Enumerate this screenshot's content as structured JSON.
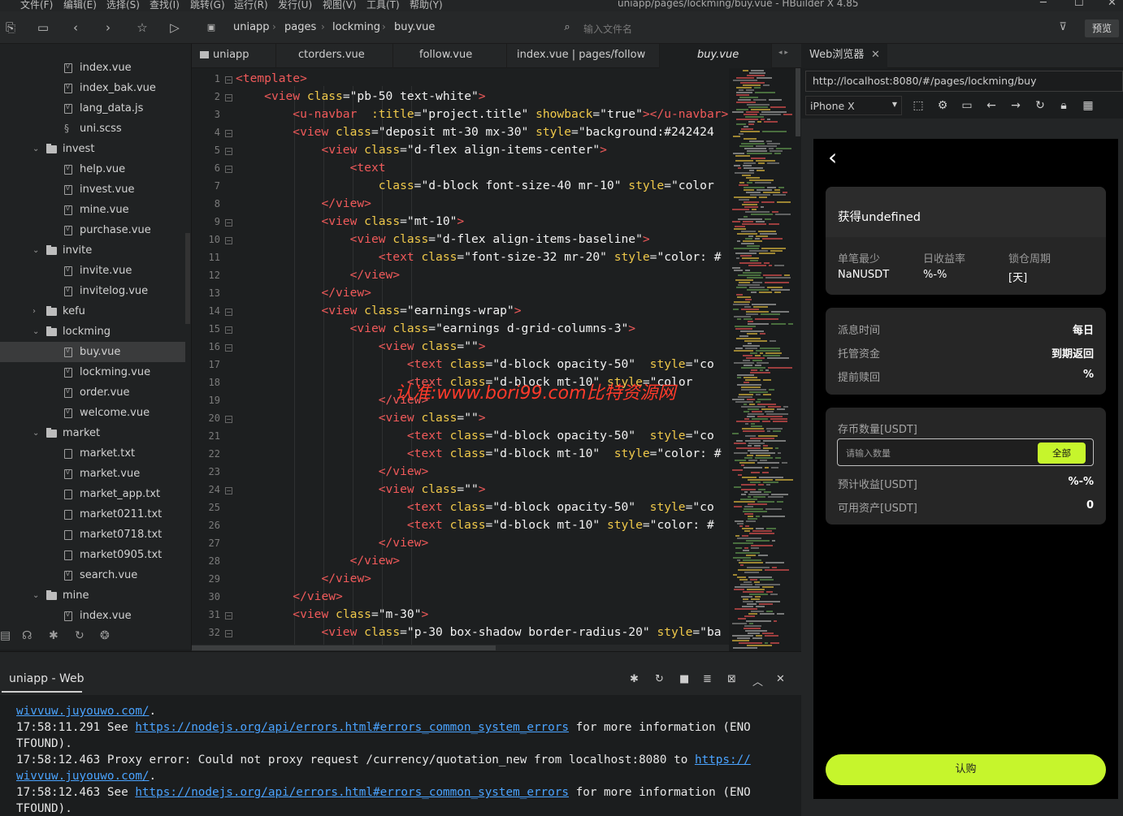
{
  "menu": [
    "文件(F)",
    "编辑(E)",
    "选择(S)",
    "查找(I)",
    "跳转(G)",
    "运行(R)",
    "发行(U)",
    "视图(V)",
    "工具(T)",
    "帮助(Y)"
  ],
  "window_title": "uniapp/pages/lockming/buy.vue - HBuilder X 4.85",
  "toolbar": {
    "breadcrumb": [
      "uniapp",
      "pages",
      "lockming",
      "buy.vue"
    ],
    "file_search_placeholder": "输入文件名",
    "preview_label": "预览"
  },
  "sidebar": {
    "items": [
      {
        "label": "index.vue",
        "kind": "file-vue",
        "depth": 2
      },
      {
        "label": "index_bak.vue",
        "kind": "file-vue",
        "depth": 2
      },
      {
        "label": "lang_data.js",
        "kind": "file-vue",
        "depth": 2
      },
      {
        "label": "uni.scss",
        "kind": "file-style",
        "depth": 2
      },
      {
        "label": "invest",
        "kind": "folder-open",
        "depth": 1
      },
      {
        "label": "help.vue",
        "kind": "file-vue",
        "depth": 2
      },
      {
        "label": "invest.vue",
        "kind": "file-vue",
        "depth": 2
      },
      {
        "label": "mine.vue",
        "kind": "file-vue",
        "depth": 2
      },
      {
        "label": "purchase.vue",
        "kind": "file-vue",
        "depth": 2
      },
      {
        "label": "invite",
        "kind": "folder-open",
        "depth": 1
      },
      {
        "label": "invite.vue",
        "kind": "file-vue",
        "depth": 2
      },
      {
        "label": "invitelog.vue",
        "kind": "file-vue",
        "depth": 2
      },
      {
        "label": "kefu",
        "kind": "folder-closed",
        "depth": 1
      },
      {
        "label": "lockming",
        "kind": "folder-open",
        "depth": 1
      },
      {
        "label": "buy.vue",
        "kind": "file-vue",
        "depth": 2,
        "selected": true
      },
      {
        "label": "lockming.vue",
        "kind": "file-vue",
        "depth": 2
      },
      {
        "label": "order.vue",
        "kind": "file-vue",
        "depth": 2
      },
      {
        "label": "welcome.vue",
        "kind": "file-vue",
        "depth": 2
      },
      {
        "label": "market",
        "kind": "folder-open",
        "depth": 1
      },
      {
        "label": "market.txt",
        "kind": "file-txt",
        "depth": 2
      },
      {
        "label": "market.vue",
        "kind": "file-vue",
        "depth": 2
      },
      {
        "label": "market_app.txt",
        "kind": "file-txt",
        "depth": 2
      },
      {
        "label": "market0211.txt",
        "kind": "file-txt",
        "depth": 2
      },
      {
        "label": "market0718.txt",
        "kind": "file-txt",
        "depth": 2
      },
      {
        "label": "market0905.txt",
        "kind": "file-txt",
        "depth": 2
      },
      {
        "label": "search.vue",
        "kind": "file-vue",
        "depth": 2
      },
      {
        "label": "mine",
        "kind": "folder-open",
        "depth": 1
      },
      {
        "label": "index.vue",
        "kind": "file-vue",
        "depth": 2
      }
    ]
  },
  "editor_tabs": [
    "uniapp",
    "ctorders.vue",
    "follow.vue",
    "index.vue | pages/follow",
    "buy.vue"
  ],
  "code_lines": [
    {
      "n": "1",
      "fold": true,
      "html": "<span class=\"t\">&lt;template&gt;</span>"
    },
    {
      "n": "2",
      "fold": true,
      "html": "    <span class=\"t\">&lt;view</span> <span class=\"a\">class</span>=<span class=\"s\">\"pb-50 text-white\"</span><span class=\"t\">&gt;</span>"
    },
    {
      "n": "3",
      "fold": false,
      "html": "        <span class=\"t\">&lt;u-navbar</span>  <span class=\"a\">:title</span>=<span class=\"s\">\"project.title\"</span> <span class=\"a\">showback</span>=<span class=\"s\">\"true\"</span><span class=\"t\">&gt;&lt;/u-navbar&gt;</span>"
    },
    {
      "n": "4",
      "fold": true,
      "html": "        <span class=\"t\">&lt;view</span> <span class=\"a\">class</span>=<span class=\"s\">\"deposit mt-30 mx-30\"</span> <span class=\"a\">style</span>=<span class=\"s\">\"background:#242424</span>"
    },
    {
      "n": "5",
      "fold": true,
      "html": "            <span class=\"t\">&lt;view</span> <span class=\"a\">class</span>=<span class=\"s\">\"d-flex align-items-center\"</span><span class=\"t\">&gt;</span>"
    },
    {
      "n": "6",
      "fold": true,
      "html": "                <span class=\"t\">&lt;text</span>"
    },
    {
      "n": "7",
      "fold": false,
      "html": "                    <span class=\"a\">class</span>=<span class=\"s\">\"d-block font-size-40 mr-10\"</span> <span class=\"a\">style</span>=<span class=\"s\">\"color</span>"
    },
    {
      "n": "8",
      "fold": false,
      "html": "            <span class=\"t\">&lt;/view&gt;</span>"
    },
    {
      "n": "9",
      "fold": true,
      "html": "            <span class=\"t\">&lt;view</span> <span class=\"a\">class</span>=<span class=\"s\">\"mt-10\"</span><span class=\"t\">&gt;</span>"
    },
    {
      "n": "10",
      "fold": true,
      "html": "                <span class=\"t\">&lt;view</span> <span class=\"a\">class</span>=<span class=\"s\">\"d-flex align-items-baseline\"</span><span class=\"t\">&gt;</span>"
    },
    {
      "n": "11",
      "fold": false,
      "html": "                    <span class=\"t\">&lt;text</span> <span class=\"a\">class</span>=<span class=\"s\">\"font-size-32 mr-20\"</span> <span class=\"a\">style</span>=<span class=\"s\">\"color: #</span>"
    },
    {
      "n": "12",
      "fold": false,
      "html": "                <span class=\"t\">&lt;/view&gt;</span>"
    },
    {
      "n": "13",
      "fold": false,
      "html": "            <span class=\"t\">&lt;/view&gt;</span>"
    },
    {
      "n": "14",
      "fold": true,
      "html": "            <span class=\"t\">&lt;view</span> <span class=\"a\">class</span>=<span class=\"s\">\"earnings-wrap\"</span><span class=\"t\">&gt;</span>"
    },
    {
      "n": "15",
      "fold": true,
      "html": "                <span class=\"t\">&lt;view</span> <span class=\"a\">class</span>=<span class=\"s\">\"earnings d-grid-columns-3\"</span><span class=\"t\">&gt;</span>"
    },
    {
      "n": "16",
      "fold": true,
      "html": "                    <span class=\"t\">&lt;view</span> <span class=\"a\">class</span>=<span class=\"s\">\"\"</span><span class=\"t\">&gt;</span>"
    },
    {
      "n": "17",
      "fold": false,
      "html": "                        <span class=\"t\">&lt;text</span> <span class=\"a\">class</span>=<span class=\"s\">\"d-block opacity-50\"</span>  <span class=\"a\">style</span>=<span class=\"s\">\"co</span>"
    },
    {
      "n": "18",
      "fold": false,
      "html": "                        <span class=\"t\">&lt;text</span> <span class=\"a\">class</span>=<span class=\"s\">\"d-block mt-10\"</span> <span class=\"a\">style</span>=<span class=\"s\">\"color</span>"
    },
    {
      "n": "19",
      "fold": false,
      "html": "                    <span class=\"t\">&lt;/view&gt;</span>"
    },
    {
      "n": "20",
      "fold": true,
      "html": "                    <span class=\"t\">&lt;view</span> <span class=\"a\">class</span>=<span class=\"s\">\"\"</span><span class=\"t\">&gt;</span>"
    },
    {
      "n": "21",
      "fold": false,
      "html": "                        <span class=\"t\">&lt;text</span> <span class=\"a\">class</span>=<span class=\"s\">\"d-block opacity-50\"</span>  <span class=\"a\">style</span>=<span class=\"s\">\"co</span>"
    },
    {
      "n": "22",
      "fold": false,
      "html": "                        <span class=\"t\">&lt;text</span> <span class=\"a\">class</span>=<span class=\"s\">\"d-block mt-10\"</span>  <span class=\"a\">style</span>=<span class=\"s\">\"color: #</span>"
    },
    {
      "n": "23",
      "fold": false,
      "html": "                    <span class=\"t\">&lt;/view&gt;</span>"
    },
    {
      "n": "24",
      "fold": true,
      "html": "                    <span class=\"t\">&lt;view</span> <span class=\"a\">class</span>=<span class=\"s\">\"\"</span><span class=\"t\">&gt;</span>"
    },
    {
      "n": "25",
      "fold": false,
      "html": "                        <span class=\"t\">&lt;text</span> <span class=\"a\">class</span>=<span class=\"s\">\"d-block opacity-50\"</span>  <span class=\"a\">style</span>=<span class=\"s\">\"co</span>"
    },
    {
      "n": "26",
      "fold": false,
      "html": "                        <span class=\"t\">&lt;text</span> <span class=\"a\">class</span>=<span class=\"s\">\"d-block mt-10\"</span> <span class=\"a\">style</span>=<span class=\"s\">\"color: #</span>"
    },
    {
      "n": "27",
      "fold": false,
      "html": "                    <span class=\"t\">&lt;/view&gt;</span>"
    },
    {
      "n": "28",
      "fold": false,
      "html": "                <span class=\"t\">&lt;/view&gt;</span>"
    },
    {
      "n": "29",
      "fold": false,
      "html": "            <span class=\"t\">&lt;/view&gt;</span>"
    },
    {
      "n": "30",
      "fold": false,
      "html": "        <span class=\"t\">&lt;/view&gt;</span>"
    },
    {
      "n": "31",
      "fold": true,
      "html": "        <span class=\"t\">&lt;view</span> <span class=\"a\">class</span>=<span class=\"s\">\"m-30\"</span><span class=\"t\">&gt;</span>"
    },
    {
      "n": "32",
      "fold": true,
      "html": "            <span class=\"t\">&lt;view</span> <span class=\"a\">class</span>=<span class=\"s\">\"p-30 box-shadow border-radius-20\"</span> <span class=\"a\">style</span>=<span class=\"s\">\"ba</span>"
    }
  ],
  "watermark": "认准:www.bori99.com比特资源网",
  "browser": {
    "tab_label": "Web浏览器",
    "url": "http://localhost:8080/#/pages/lockming/buy",
    "device": "iPhone X"
  },
  "phone": {
    "card1": {
      "title": "获得undefined",
      "labels": [
        "单笔最少",
        "日收益率",
        "锁仓周期"
      ],
      "values": [
        "NaNUSDT",
        "%-%",
        "[天]"
      ]
    },
    "card2": {
      "rows": [
        {
          "label": "派息时间",
          "value": "每日"
        },
        {
          "label": "托管资金",
          "value": "到期返回"
        },
        {
          "label": "提前赎回",
          "value": "%"
        }
      ]
    },
    "card3": {
      "amount_label": "存币数量[USDT]",
      "amount_placeholder": "请输入数量",
      "all_label": "全部",
      "rows": [
        {
          "label": "预计收益[USDT]",
          "value": "%-%"
        },
        {
          "label": "可用资产[USDT]",
          "value": "0"
        }
      ]
    },
    "buy_label": "认购"
  },
  "console": {
    "title": "uniapp - Web",
    "lines": [
      "<span class=\"clink\">wivvuw.juyouwo.com/</span>.",
      "17:58:11.291 See <span class=\"clink\">https://nodejs.org/api/errors.html#errors_common_system_errors</span> for more information (ENO",
      "TFOUND).",
      "17:58:12.463 Proxy error: Could not proxy request /currency/quotation_new from localhost:8080 to <span class=\"clink\">https://</span>",
      "<span class=\"clink\">wivvuw.juyouwo.com/</span>.",
      "17:58:12.463 See <span class=\"clink\">https://nodejs.org/api/errors.html#errors_common_system_errors</span> for more information (ENO",
      "TFOUND)."
    ]
  }
}
